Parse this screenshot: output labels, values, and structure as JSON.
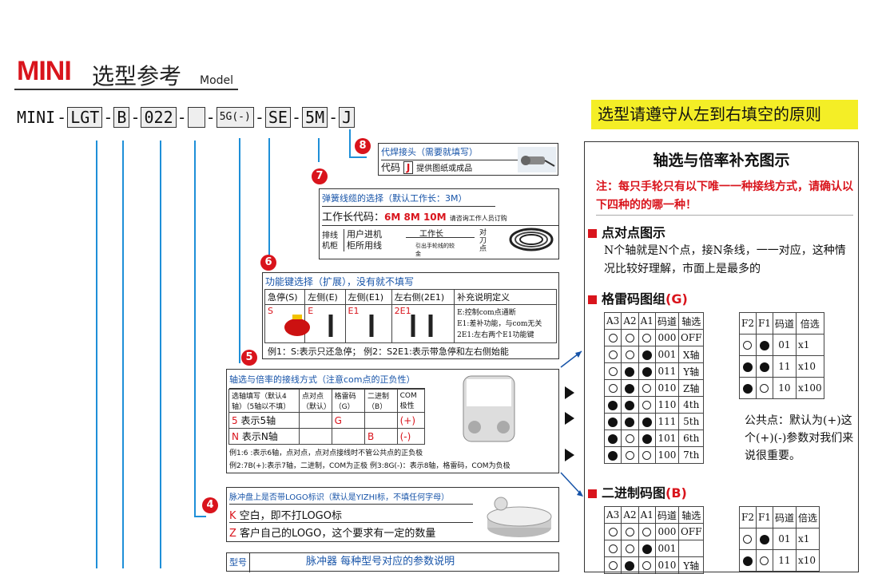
{
  "title": {
    "mini": "MINI",
    "cn": "选型参考",
    "en": "Model"
  },
  "code": {
    "parts": [
      "MINI",
      "LGT",
      "B",
      "022",
      "",
      "5G",
      "(-)",
      "SE",
      "5M",
      "J"
    ]
  },
  "banner": "选型请遵守从左到右填空的原则",
  "nums": [
    "8",
    "7",
    "6",
    "5",
    "4"
  ],
  "s8": {
    "title": "代焊接头（需要就填写）",
    "label": "代码",
    "code": "J",
    "desc": "提供图纸或成品"
  },
  "s7": {
    "title": "弹簧线缆的选择（默认工作长：3M）",
    "len_label": "工作长代码：",
    "codes": "6M  8M  10M",
    "note": "请咨询工作人员订购",
    "r1": "排线",
    "r2": "机柜",
    "r3": "用户进机",
    "r4": "柜所用线",
    "work": "工作长",
    "lead": "引出手轮线的较金",
    "knife": "对刀点"
  },
  "s6": {
    "title": "功能键选择（扩展），没有就不填写",
    "headers": [
      "急停(S)",
      "左侧(E)",
      "左侧(E1)",
      "左右侧(2E1)",
      "补充说明定义"
    ],
    "codes": [
      "S",
      "E",
      "E1",
      "2E1"
    ],
    "notes": [
      "E:控制com点通断",
      "E1:差补功能，与com无关",
      "2E1:左右两个E1功能键"
    ],
    "example": "例1：S:表示只还急停；  例2：S2E1:表示带急停和左右侧始能"
  },
  "s5": {
    "title": "轴选与倍率的接线方式（注意com点的正负性）",
    "headers": [
      "选轴填写（默认4轴）（5轴以不填）",
      "点对点（默认）",
      "格雷码（G）",
      "二进制（B）",
      "COM极性"
    ],
    "rows": [
      [
        "5",
        "表示5轴",
        "G",
        "",
        "(+)"
      ],
      [
        "N",
        "表示N轴",
        "",
        "B",
        "(-)"
      ]
    ],
    "ex1": "例1:6 :表示6轴，点对点，点对点接线时不管公共点的正负极",
    "ex2": "例2:7B(+):表示7轴，二进制，COM为正极     例3:8G(-)：表示8轴，格雷码，COM为负极"
  },
  "s4": {
    "title": "脉冲盘上是否带LOGO标识（默认是YIZHI标，不填任何字母）",
    "rows": [
      [
        "K",
        "空白，即不打LOGO标"
      ],
      [
        "Z",
        "客户自己的LOGO，这个要求有一定的数量"
      ]
    ]
  },
  "s3": {
    "label": "型号",
    "title": "脉冲器 每种型号对应的参数说明"
  },
  "panel": {
    "title": "轴选与倍率补充图示",
    "note": "注：每只手轮只有以下唯一一种接线方式，请确认以下四种的的哪一种！",
    "p2p_title": "点对点图示",
    "p2p_text": "N个轴就是N个点，接N条线，一一对应，这种情况比较好理解，市面上是最多的",
    "gray_title": "格雷码图组",
    "gray_code": "(G)",
    "bin_title": "二进制码图",
    "bin_code": "(B)",
    "axis_headers": [
      "A3",
      "A2",
      "A1",
      "码道",
      "轴选"
    ],
    "gray_rows": [
      [
        "o",
        "o",
        "o",
        "000",
        "OFF"
      ],
      [
        "o",
        "o",
        "f",
        "001",
        "X轴"
      ],
      [
        "o",
        "f",
        "f",
        "011",
        "Y轴"
      ],
      [
        "o",
        "f",
        "o",
        "010",
        "Z轴"
      ],
      [
        "f",
        "f",
        "o",
        "110",
        "4th"
      ],
      [
        "f",
        "f",
        "f",
        "111",
        "5th"
      ],
      [
        "f",
        "o",
        "f",
        "101",
        "6th"
      ],
      [
        "f",
        "o",
        "o",
        "100",
        "7th"
      ]
    ],
    "bin_rows": [
      [
        "o",
        "o",
        "o",
        "000",
        "OFF"
      ],
      [
        "o",
        "o",
        "f",
        "001",
        ""
      ],
      [
        "o",
        "f",
        "o",
        "010",
        "Y轴"
      ]
    ],
    "rate_headers": [
      "F2",
      "F1",
      "码道",
      "倍选"
    ],
    "gray_rate": [
      [
        "o",
        "f",
        "01",
        "x1"
      ],
      [
        "f",
        "f",
        "11",
        "x10"
      ],
      [
        "f",
        "o",
        "10",
        "x100"
      ]
    ],
    "bin_rate": [
      [
        "o",
        "f",
        "01",
        "x1"
      ],
      [
        "f",
        "o",
        "11",
        "x10"
      ]
    ],
    "common": "公共点：默认为(+)这个(+)(-)参数对我们来说很重要。"
  }
}
